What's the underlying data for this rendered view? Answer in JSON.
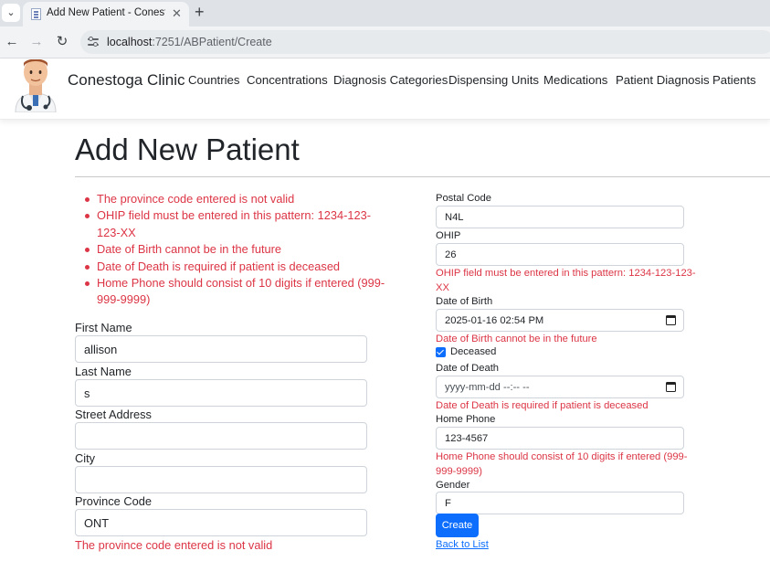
{
  "browser": {
    "tab_title": "Add New Patient - Conestoga Clinic",
    "tab_close": "✕",
    "new_tab": "+",
    "tab_menu": "⌄",
    "url_host": "localhost",
    "url_path": ":7251/ABPatient/Create",
    "back": "←",
    "forward": "→",
    "reload": "↻"
  },
  "site": {
    "brand": "Conestoga Clinic",
    "nav": [
      "Countries",
      "Concentrations",
      "Diagnosis Categories",
      "Dispensing Units",
      "Medications",
      "Patient Diagnosis",
      "Patients"
    ]
  },
  "page": {
    "title": "Add New Patient",
    "validation_summary": [
      "The province code entered is not valid",
      "OHIP field must be entered in this pattern: 1234-123-123-XX",
      "Date of Birth cannot be in the future",
      "Date of Death is required if patient is deceased",
      "Home Phone should consist of 10 digits if entered (999-999-9999)"
    ]
  },
  "form": {
    "first_name": {
      "label": "First Name",
      "value": "allison"
    },
    "last_name": {
      "label": "Last Name",
      "value": "s"
    },
    "street_address": {
      "label": "Street Address",
      "value": ""
    },
    "city": {
      "label": "City",
      "value": ""
    },
    "province_code": {
      "label": "Province Code",
      "value": "ONT",
      "error": "The province code entered is not valid"
    },
    "postal_code": {
      "label": "Postal Code",
      "value": "N4L"
    },
    "ohip": {
      "label": "OHIP",
      "value": "26",
      "error_line1": "OHIP field must be entered in this pattern: 1234-123-123-",
      "error_line2": "XX"
    },
    "date_of_birth": {
      "label": "Date of Birth",
      "value": "2025-01-16 02:54 PM",
      "error": "Date of Birth cannot be in the future"
    },
    "deceased": {
      "label": "Deceased",
      "checked": true
    },
    "date_of_death": {
      "label": "Date of Death",
      "value": "yyyy-mm-dd --:-- --",
      "error": "Date of Death is required if patient is deceased"
    },
    "home_phone": {
      "label": "Home Phone",
      "value": "123-4567",
      "error_line1": "Home Phone should consist of 10 digits if entered (999-",
      "error_line2": "999-9999)"
    },
    "gender": {
      "label": "Gender",
      "value": "F"
    },
    "create_label": "Create",
    "back_label": "Back to List"
  },
  "colors": {
    "error": "#dc3545",
    "primary": "#0d6efd",
    "text": "#212529"
  }
}
